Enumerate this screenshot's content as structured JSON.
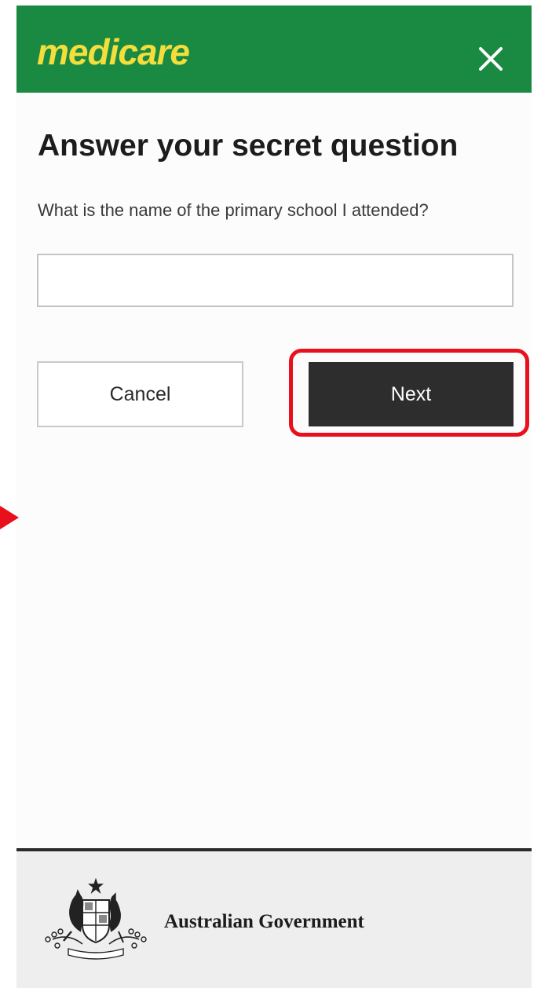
{
  "header": {
    "logo_text": "medicare",
    "close_icon": "close-icon",
    "background_color": "#1a8a43",
    "logo_color": "#f3de3c"
  },
  "main": {
    "title": "Answer your secret question",
    "question": "What is the name of the primary school I attended?",
    "answer_value": "",
    "answer_placeholder": "",
    "cancel_label": "Cancel",
    "next_label": "Next"
  },
  "annotations": {
    "highlight_color": "#e8101c",
    "highlight_target": "next-button",
    "pointer_icon": "triangle-arrow-icon"
  },
  "footer": {
    "crest_icon": "coat-of-arms-icon",
    "government_label": "Australian Government"
  }
}
